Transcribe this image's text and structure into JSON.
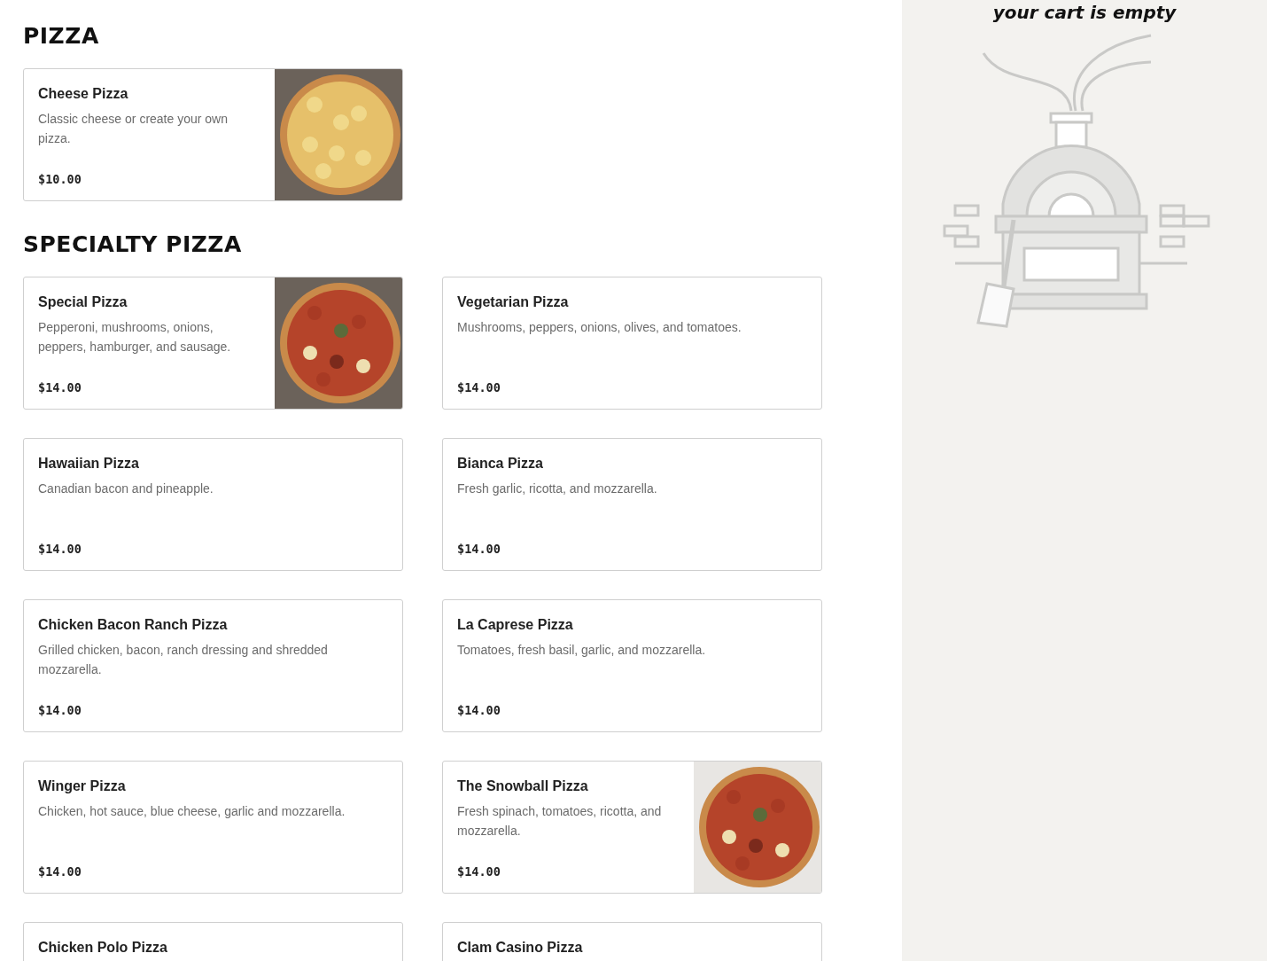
{
  "sections": [
    {
      "title": "PIZZA",
      "items": [
        {
          "name": "Cheese Pizza",
          "description": "Classic cheese or create your own pizza.",
          "price": "$10.00"
        }
      ]
    },
    {
      "title": "SPECIALTY PIZZA",
      "items": [
        {
          "name": "Special Pizza",
          "description": "Pepperoni, mushrooms, onions, peppers, hamburger, and sausage.",
          "price": "$14.00"
        },
        {
          "name": "Vegetarian Pizza",
          "description": "Mushrooms, peppers, onions, olives, and tomatoes.",
          "price": "$14.00"
        },
        {
          "name": "Hawaiian Pizza",
          "description": "Canadian bacon and pineapple.",
          "price": "$14.00"
        },
        {
          "name": "Bianca Pizza",
          "description": "Fresh garlic, ricotta, and mozzarella.",
          "price": "$14.00"
        },
        {
          "name": "Chicken Bacon Ranch Pizza",
          "description": "Grilled chicken, bacon, ranch dressing and shredded mozzarella.",
          "price": "$14.00"
        },
        {
          "name": "La Caprese Pizza",
          "description": "Tomatoes, fresh basil, garlic, and mozzarella.",
          "price": "$14.00"
        },
        {
          "name": "Winger Pizza",
          "description": "Chicken, hot sauce, blue cheese, garlic and mozzarella.",
          "price": "$14.00"
        },
        {
          "name": "The Snowball Pizza",
          "description": "Fresh spinach, tomatoes, ricotta, and mozzarella.",
          "price": "$14.00"
        },
        {
          "name": "Chicken Polo Pizza"
        },
        {
          "name": "Clam Casino Pizza"
        }
      ]
    }
  ],
  "cart": {
    "message": "your cart is empty"
  }
}
